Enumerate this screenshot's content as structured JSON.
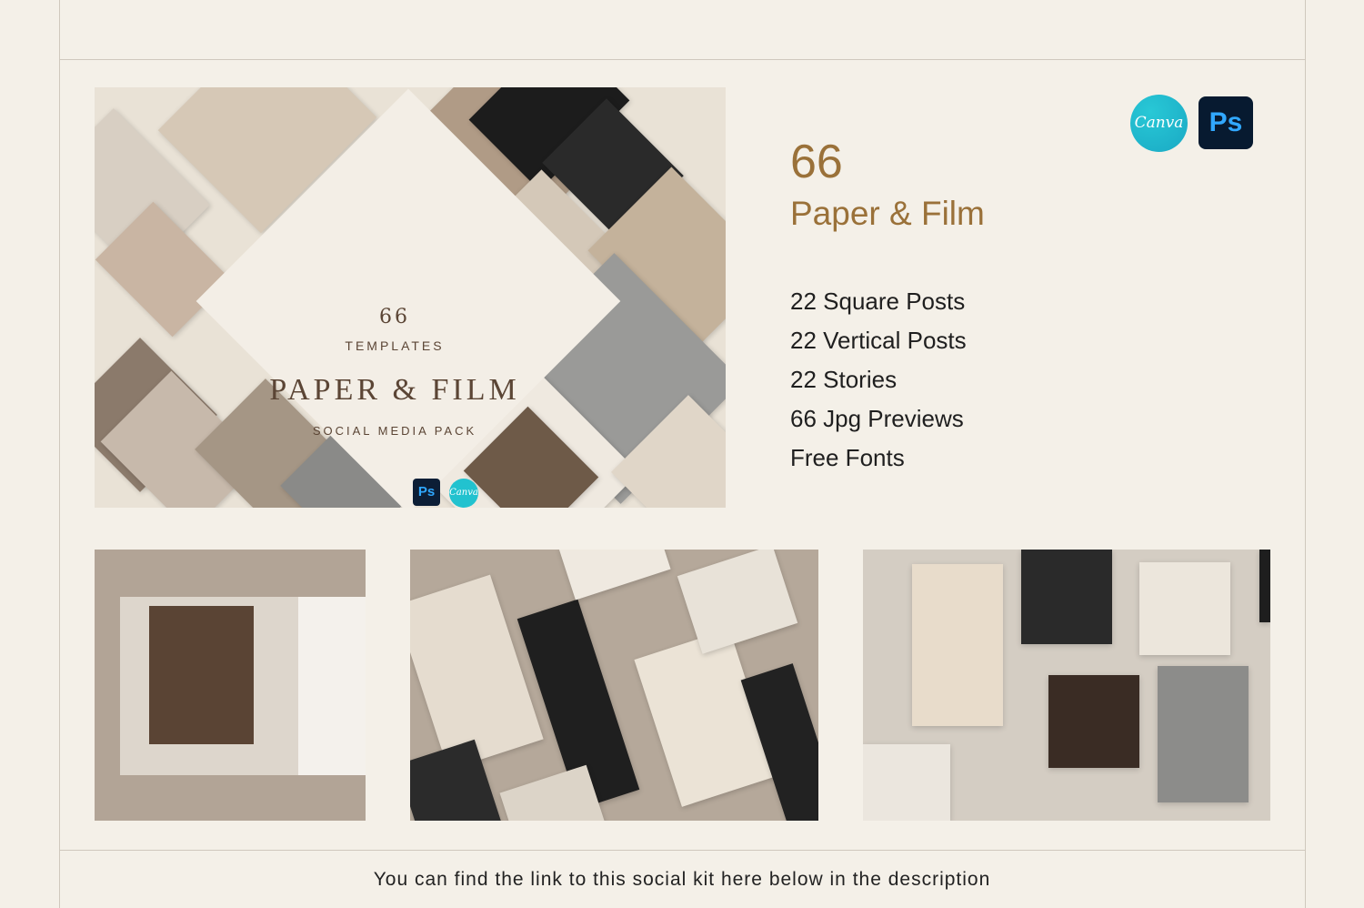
{
  "hero": {
    "count": "66",
    "templates_label": "TEMPLATES",
    "title": "PAPER & FILM",
    "subtitle": "SOCIAL MEDIA PACK",
    "ps_label": "Ps",
    "canva_label": "Canva"
  },
  "logos": {
    "canva": "Canva",
    "ps": "Ps"
  },
  "info": {
    "count": "66",
    "title": "Paper & Film",
    "features": [
      "22 Square Posts",
      "22 Vertical Posts",
      "22 Stories",
      "66 Jpg Previews",
      "Free Fonts"
    ]
  },
  "footer": {
    "text": "You can find the link to this social kit here below in the description"
  },
  "colors": {
    "background": "#f4f0e8",
    "accent": "#9a7139",
    "canva": "#22c2cf",
    "ps_bg": "#071a30",
    "ps_fg": "#31a8ff"
  }
}
